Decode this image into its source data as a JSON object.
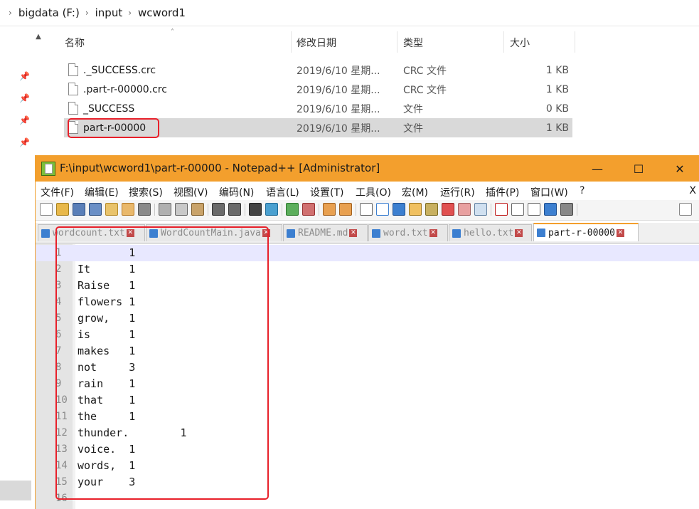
{
  "explorer": {
    "breadcrumb": [
      "bigdata (F:)",
      "input",
      "wcword1"
    ],
    "columns": {
      "name": "名称",
      "date": "修改日期",
      "type": "类型",
      "size": "大小"
    },
    "files": [
      {
        "name": "._SUCCESS.crc",
        "date": "2019/6/10 星期...",
        "type": "CRC 文件",
        "size": "1 KB"
      },
      {
        "name": ".part-r-00000.crc",
        "date": "2019/6/10 星期...",
        "type": "CRC 文件",
        "size": "1 KB"
      },
      {
        "name": "_SUCCESS",
        "date": "2019/6/10 星期...",
        "type": "文件",
        "size": "0 KB"
      },
      {
        "name": "part-r-00000",
        "date": "2019/6/10 星期...",
        "type": "文件",
        "size": "1 KB"
      }
    ],
    "selected_file_index": 3
  },
  "notepad": {
    "title": "F:\\input\\wcword1\\part-r-00000 - Notepad++ [Administrator]",
    "menu": [
      "文件(F)",
      "编辑(E)",
      "搜索(S)",
      "视图(V)",
      "编码(N)",
      "语言(L)",
      "设置(T)",
      "工具(O)",
      "宏(M)",
      "运行(R)",
      "插件(P)",
      "窗口(W)",
      "?"
    ],
    "menu_close": "X",
    "tabs": [
      {
        "label": "wordcount.txt",
        "active": false
      },
      {
        "label": "WordCountMain.java",
        "active": false
      },
      {
        "label": "README.md",
        "active": false
      },
      {
        "label": "word.txt",
        "active": false
      },
      {
        "label": "hello.txt",
        "active": false
      },
      {
        "label": "part-r-00000",
        "active": true
      }
    ],
    "lines": [
      "\t1",
      "It\t1",
      "Raise\t1",
      "flowers\t1",
      "grow,\t1",
      "is\t1",
      "makes\t1",
      "not\t3",
      "rain\t1",
      "that\t1",
      "the\t1",
      "thunder.\t1",
      "voice.\t1",
      "words,\t1",
      "your\t3",
      ""
    ],
    "line_numbers": [
      "1",
      "2",
      "3",
      "4",
      "5",
      "6",
      "7",
      "8",
      "9",
      "10",
      "11",
      "12",
      "13",
      "14",
      "15",
      "16"
    ],
    "current_line": 1
  },
  "colors": {
    "title_bar": "#f39f2d",
    "highlight_box": "#e8202a",
    "selection": "#d9d9d9",
    "current_line": "#e8e8ff"
  },
  "icons": {
    "pin": "pin-icon",
    "file": "file-icon",
    "app": "notepadpp-icon",
    "tab": "save-disk-icon",
    "tab_close": "close-icon"
  }
}
